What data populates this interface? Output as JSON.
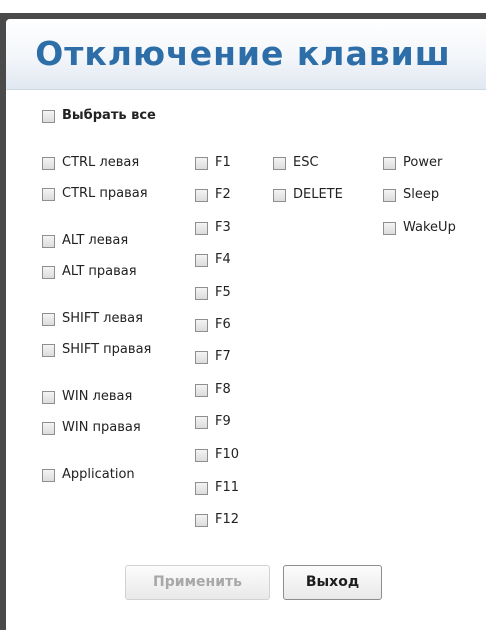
{
  "title": "Отключение клавиш",
  "select_all": "Выбрать все",
  "col1": [
    "CTRL левая",
    "CTRL правая",
    "ALT левая",
    "ALT правая",
    "SHIFT левая",
    "SHIFT правая",
    "WIN левая",
    "WIN правая",
    "Application"
  ],
  "col2": [
    "F1",
    "F2",
    "F3",
    "F4",
    "F5",
    "F6",
    "F7",
    "F8",
    "F9",
    "F10",
    "F11",
    "F12"
  ],
  "col3": [
    "ESC",
    "DELETE"
  ],
  "col4": [
    "Power",
    "Sleep",
    "WakeUp"
  ],
  "buttons": {
    "apply": "Применить",
    "exit": "Выход"
  }
}
